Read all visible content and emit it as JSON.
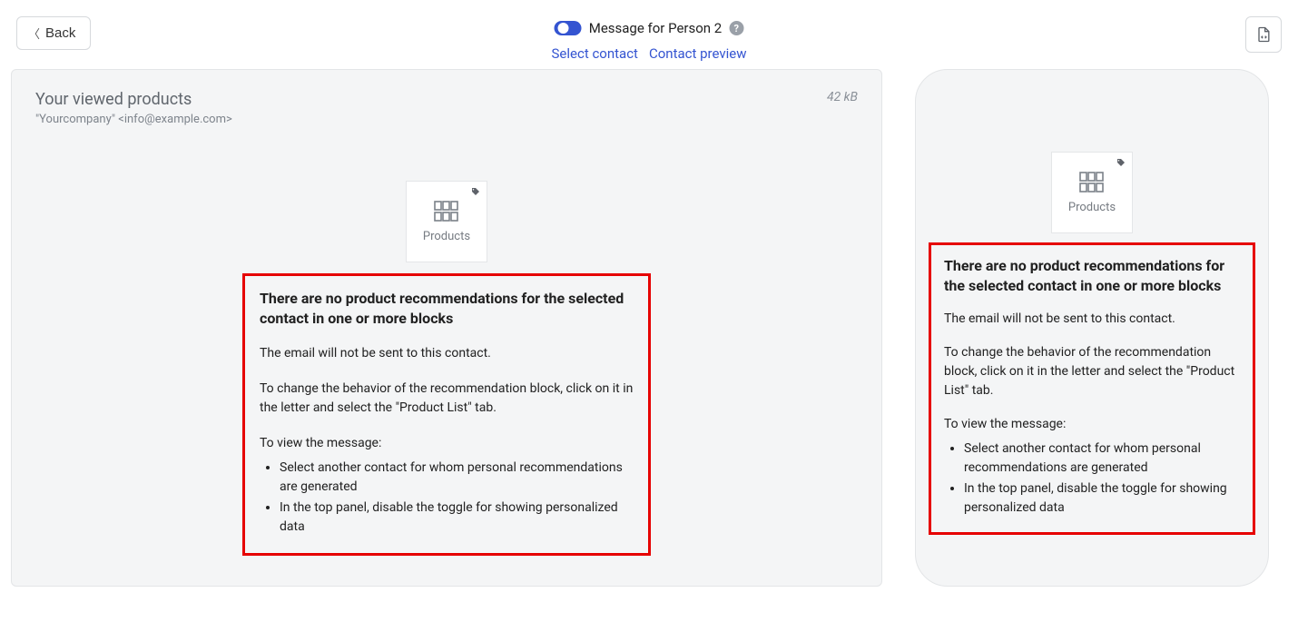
{
  "topbar": {
    "back_label": "Back",
    "toggle_label": "Message for Person 2",
    "select_contact_label": "Select contact",
    "contact_preview_label": "Contact preview"
  },
  "desktop": {
    "title": "Your viewed products",
    "sender": "\"Yourcompany\" <info@example.com>",
    "size": "42 kB",
    "product_label": "Products"
  },
  "mobile": {
    "product_label": "Products"
  },
  "alert": {
    "heading": "There are no product recommendations for the selected contact in one or more blocks",
    "line1": "The email will not be sent to this contact.",
    "line2": "To change the behavior of the recommendation block, click on it in the letter and select the \"Product List\" tab.",
    "line3": "To view the message:",
    "bullet1": "Select another contact for whom personal recommendations are generated",
    "bullet2": "In the top panel, disable the toggle for showing personalized data"
  }
}
